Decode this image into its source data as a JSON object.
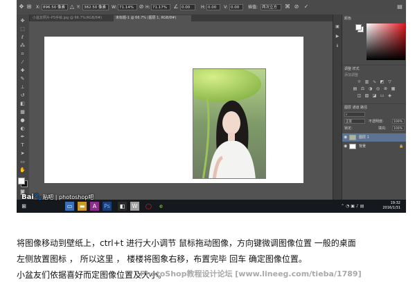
{
  "options_bar": {
    "x_label": "X:",
    "x_value": "896.50 像素",
    "y_label": "Y:",
    "y_value": "382.50 像素",
    "w_label": "W:",
    "w_value": "71.14%",
    "h_label": "H:",
    "h_value": "71.17%",
    "angle_value": "0.00",
    "h2_label": "H:",
    "h2_value": "0.00",
    "v_label": "V:",
    "v_value": "0.00",
    "interp_label": "插值:",
    "interp_value": "两次立方"
  },
  "doc_tabs": [
    {
      "label": "小盆友照片-PS手绘.jpg @ 66.7%(RGB/8#)",
      "active": false
    },
    {
      "label": "未标题-1 @ 66.7% (图层 1, RGB/8#)",
      "active": true
    }
  ],
  "panels": {
    "color_tab": "颜色",
    "adjust_tabs": "调整  样式",
    "adjust_add": "添加调整",
    "layers_tabs": "图层  通道  路径",
    "blend_mode": "正常",
    "opacity_label": "不透明度:",
    "opacity_value": "100%",
    "lock_label": "锁定:",
    "fill_label": "填充:",
    "fill_value": "100%",
    "layers": [
      {
        "name": "图层 1",
        "selected": true
      },
      {
        "name": "背景",
        "selected": false
      }
    ]
  },
  "taskbar": {
    "time": "19:32",
    "date": "2016/1/31"
  },
  "watermark_baidu": {
    "text": "Bai",
    "paw": "🐾",
    "suffix": "贴吧 | photoshop吧"
  },
  "caption": {
    "line1": "将图像移动到壁纸上，ctrl+t 进行大小调节 鼠标拖动图像，方向键微调图像位置 一般的桌面",
    "line2": "左侧放置图标 ， 所以这里 ， 楼楼将图象右移，布置完毕 回车 确定图像位置。",
    "line3": "小盆友们依据喜好而定图像位置及大小。"
  },
  "watermark_bottom": "PhotoShop教程设计论坛  [www.lineeg.com/tieba/1789]",
  "colors": {
    "ps_bg": "#535353",
    "selected_layer": "#5d7393",
    "taskbar": "#15191e"
  }
}
